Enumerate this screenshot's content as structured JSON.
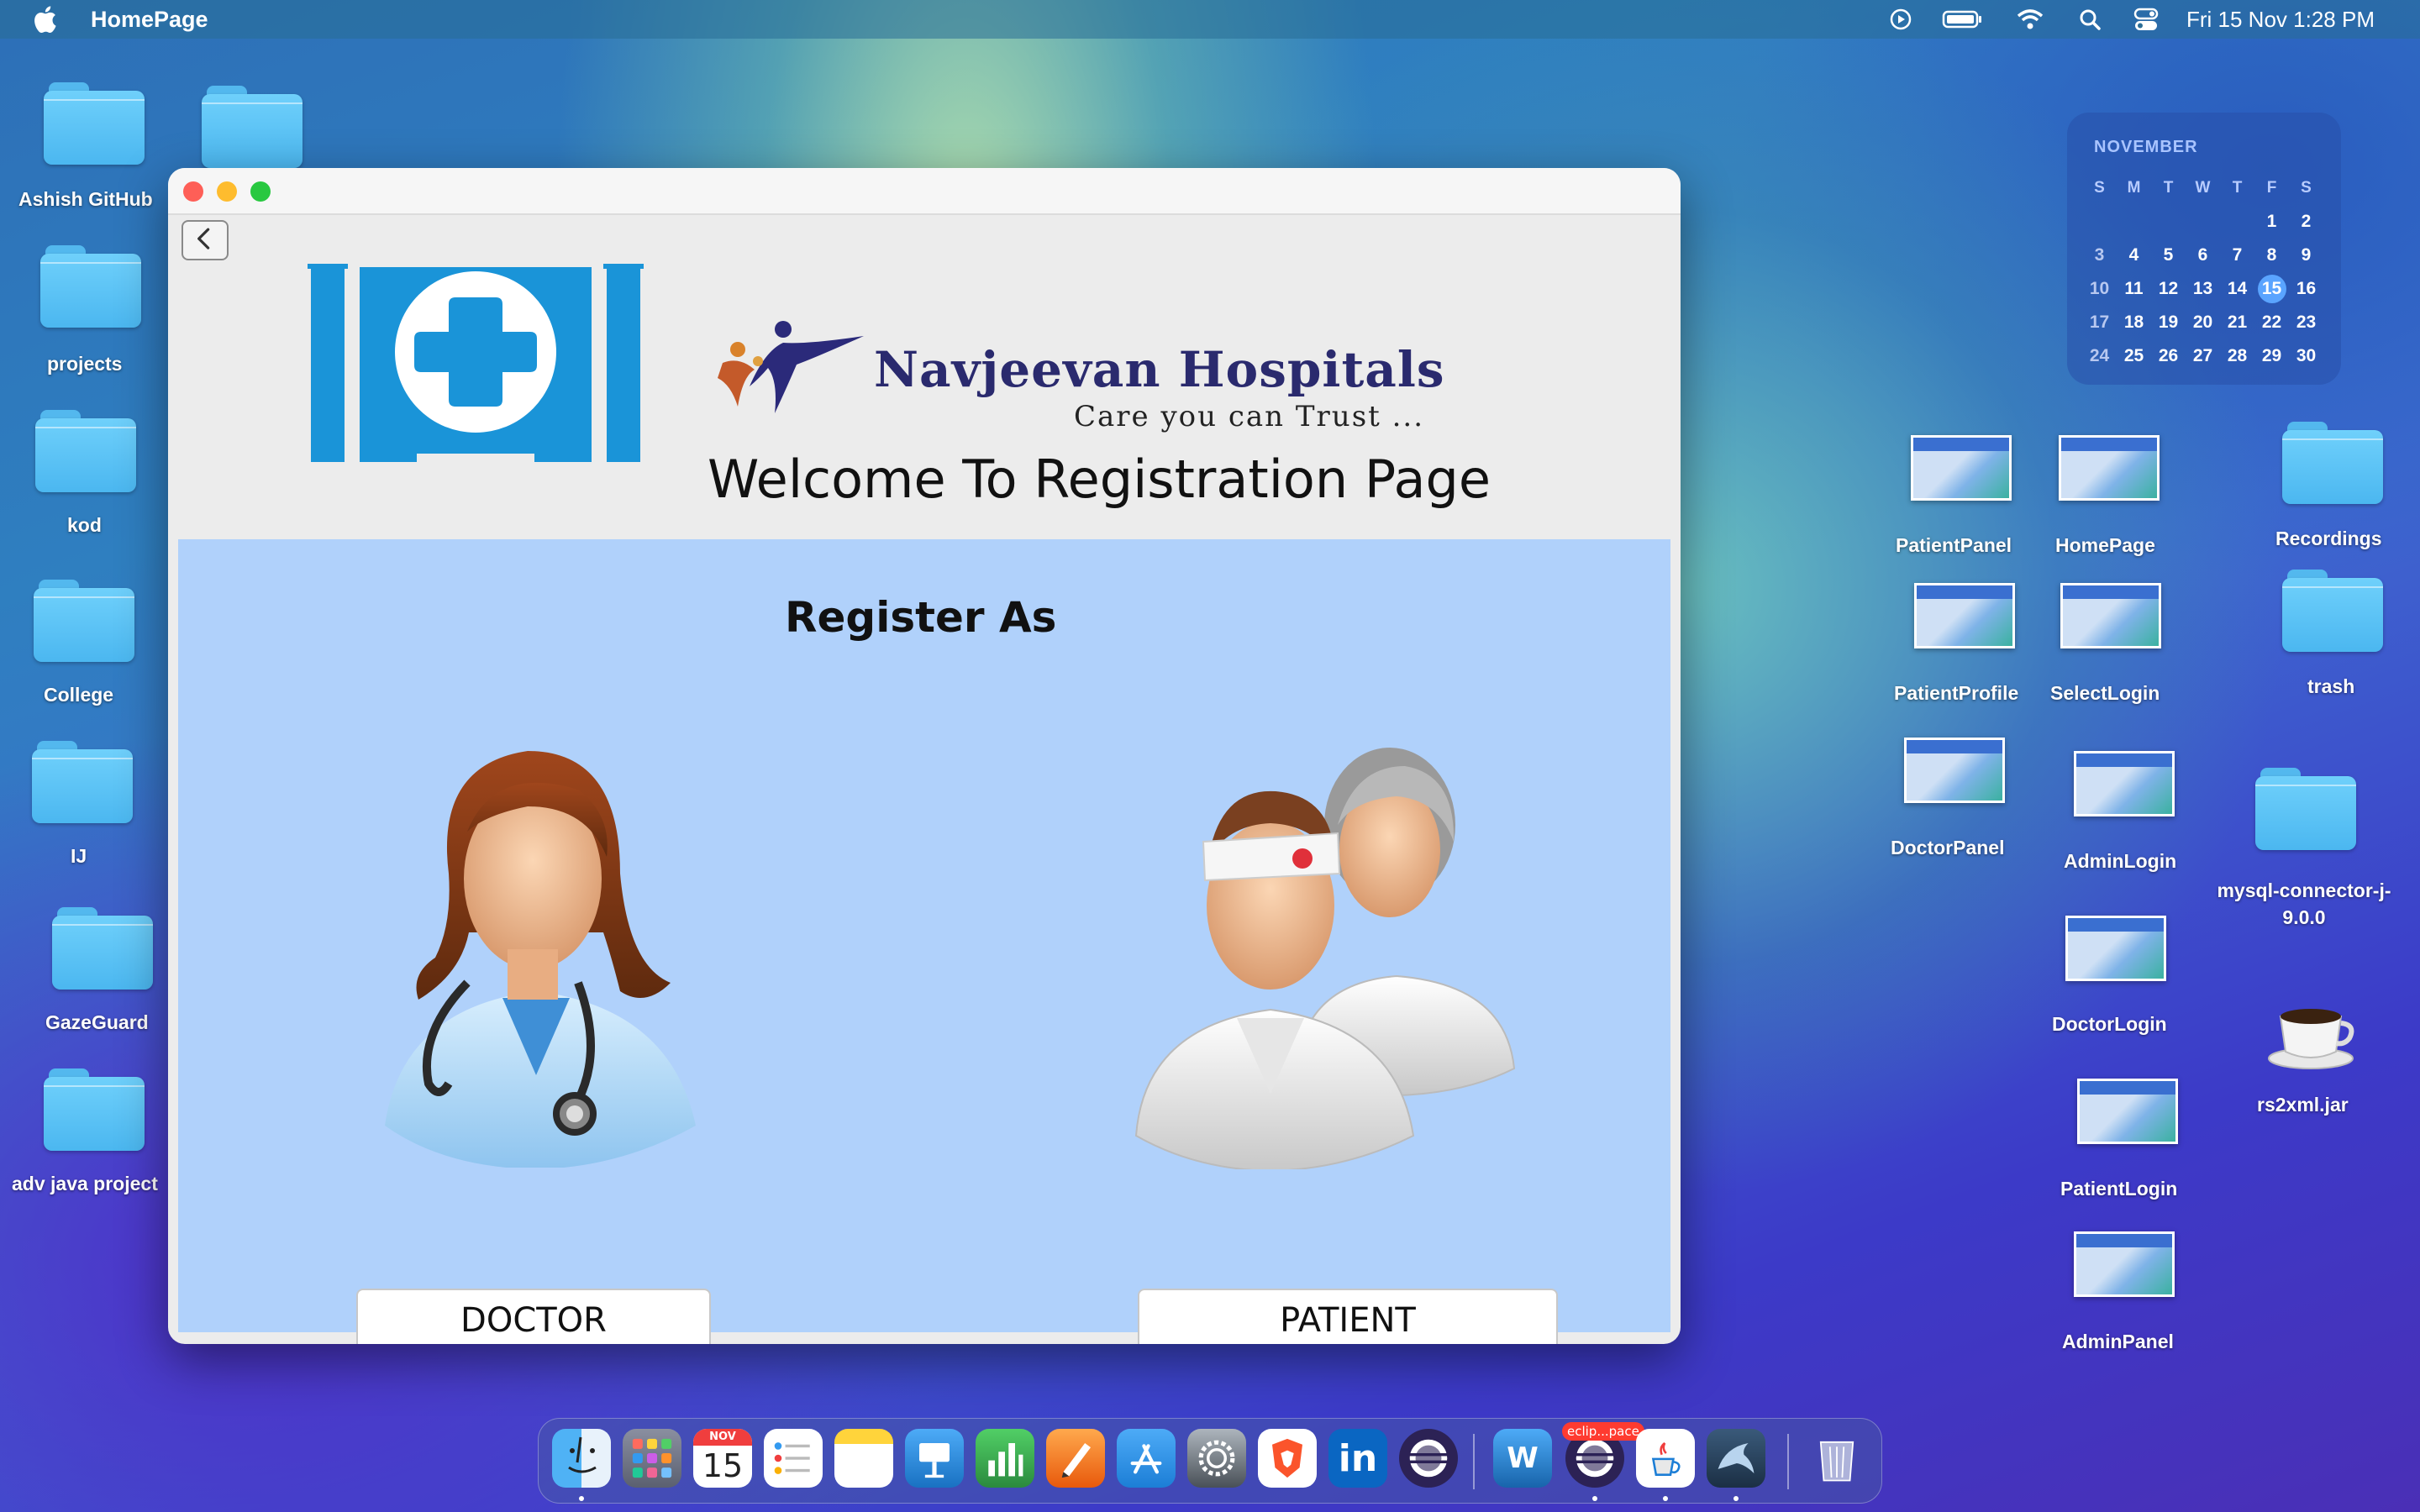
{
  "menubar": {
    "app_name": "HomePage",
    "clock": "Fri 15 Nov  1:28 PM",
    "status_icons": [
      "play-circle-icon",
      "battery-icon",
      "wifi-icon",
      "search-icon",
      "control-center-icon"
    ]
  },
  "desktop": {
    "left_folders": [
      {
        "label": "Ashish GitHub"
      },
      {
        "label": ""
      },
      {
        "label": "projects"
      },
      {
        "label": "kod"
      },
      {
        "label": "College"
      },
      {
        "label": "IJ"
      },
      {
        "label": "GazeGuard"
      },
      {
        "label": "adv java project"
      }
    ],
    "right_items": [
      {
        "label": "PatientPanel"
      },
      {
        "label": "HomePage"
      },
      {
        "label": "Recordings"
      },
      {
        "label": "PatientProfile"
      },
      {
        "label": "SelectLogin"
      },
      {
        "label": "trash"
      },
      {
        "label": "DoctorPanel"
      },
      {
        "label": "AdminLogin"
      },
      {
        "label": "mysql-connector-j-9.0.0"
      },
      {
        "label": "DoctorLogin"
      },
      {
        "label": "rs2xml.jar"
      },
      {
        "label": "PatientLogin"
      },
      {
        "label": "AdminPanel"
      }
    ]
  },
  "calendar": {
    "month": "NOVEMBER",
    "weekdays": [
      "S",
      "M",
      "T",
      "W",
      "T",
      "F",
      "S"
    ],
    "weeks": [
      [
        "",
        "",
        "",
        "",
        "",
        "1",
        "2"
      ],
      [
        "3",
        "4",
        "5",
        "6",
        "7",
        "8",
        "9"
      ],
      [
        "10",
        "11",
        "12",
        "13",
        "14",
        "15",
        "16"
      ],
      [
        "17",
        "18",
        "19",
        "20",
        "21",
        "22",
        "23"
      ],
      [
        "24",
        "25",
        "26",
        "27",
        "28",
        "29",
        "30"
      ]
    ],
    "today": "15"
  },
  "window": {
    "hospital_name": "Navjeevan Hospitals",
    "hospital_tagline": "Care you can Trust ...",
    "welcome_title": "Welcome To Registration Page",
    "register_heading": "Register As",
    "doctor_button": "DOCTOR",
    "patient_button": "PATIENT",
    "colors": {
      "panel": "#b0d1fb",
      "logo_blue": "#1a94d8",
      "hospital_text": "#2a2a6e"
    }
  },
  "dock": {
    "calendar_month": "NOV",
    "calendar_day": "15",
    "eclipse_badge": "eclip...pace",
    "apps": [
      "finder-icon",
      "launchpad-icon",
      "calendar-icon",
      "reminders-icon",
      "notes-icon",
      "keynote-icon",
      "numbers-icon",
      "pages-icon",
      "app-store-icon",
      "system-settings-icon",
      "brave-icon",
      "linkedin-icon",
      "eclipse-icon",
      "word-icon",
      "eclipse-workspace-icon",
      "java-icon",
      "mysql-workbench-icon",
      "trash-icon"
    ]
  }
}
